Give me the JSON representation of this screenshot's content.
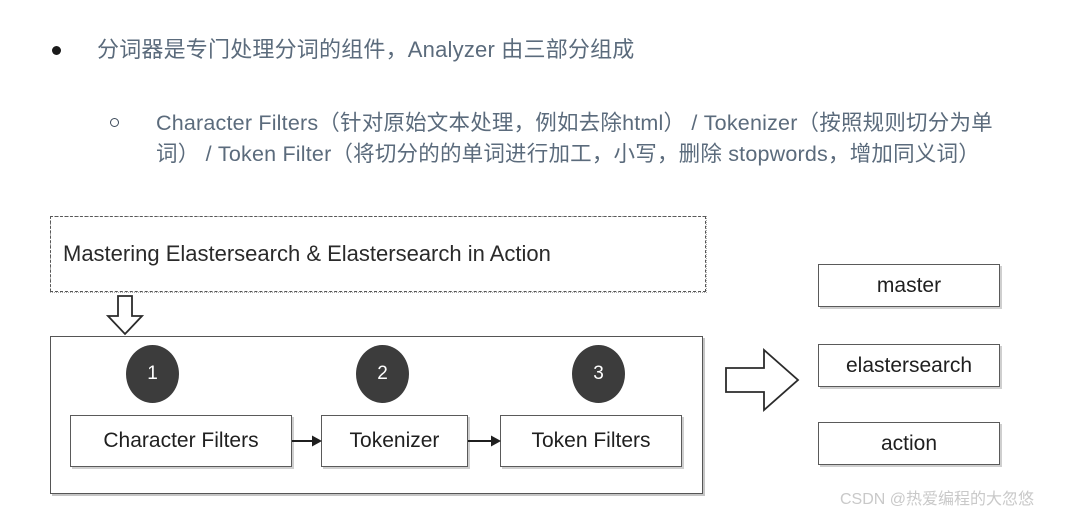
{
  "bullets": [
    {
      "marker": "filled-disc",
      "text": "分词器是专门处理分词的组件，Analyzer 由三部分组成"
    },
    {
      "marker": "hollow-circle",
      "text": "Character Filters（针对原始文本处理，例如去除html） / Tokenizer（按照规则切分为单词） / Token Filter（将切分的的单词进行加工，小写，删除 stopwords，增加同义词）"
    }
  ],
  "diagram": {
    "source_box": {
      "label": "Mastering Elastersearch & Elastersearch in Action",
      "border_style": "dash-dot"
    },
    "down_arrow_name": "down-block-arrow",
    "pipeline": {
      "steps": [
        {
          "number": "1",
          "label": "Character Filters"
        },
        {
          "number": "2",
          "label": "Tokenizer"
        },
        {
          "number": "3",
          "label": "Token Filters"
        }
      ],
      "circle_color": "#3c3c3c",
      "circle_text_color": "#ffffff"
    },
    "right_arrow_name": "right-block-arrow",
    "tokens": [
      "master",
      "elastersearch",
      "action"
    ]
  },
  "watermark": "CSDN @热爱编程的大忽悠",
  "colors": {
    "bullet_text": "#5b6b7c",
    "box_border": "#555555",
    "diagram_text": "#1f1f1f",
    "watermark": "#c9c9c9"
  }
}
